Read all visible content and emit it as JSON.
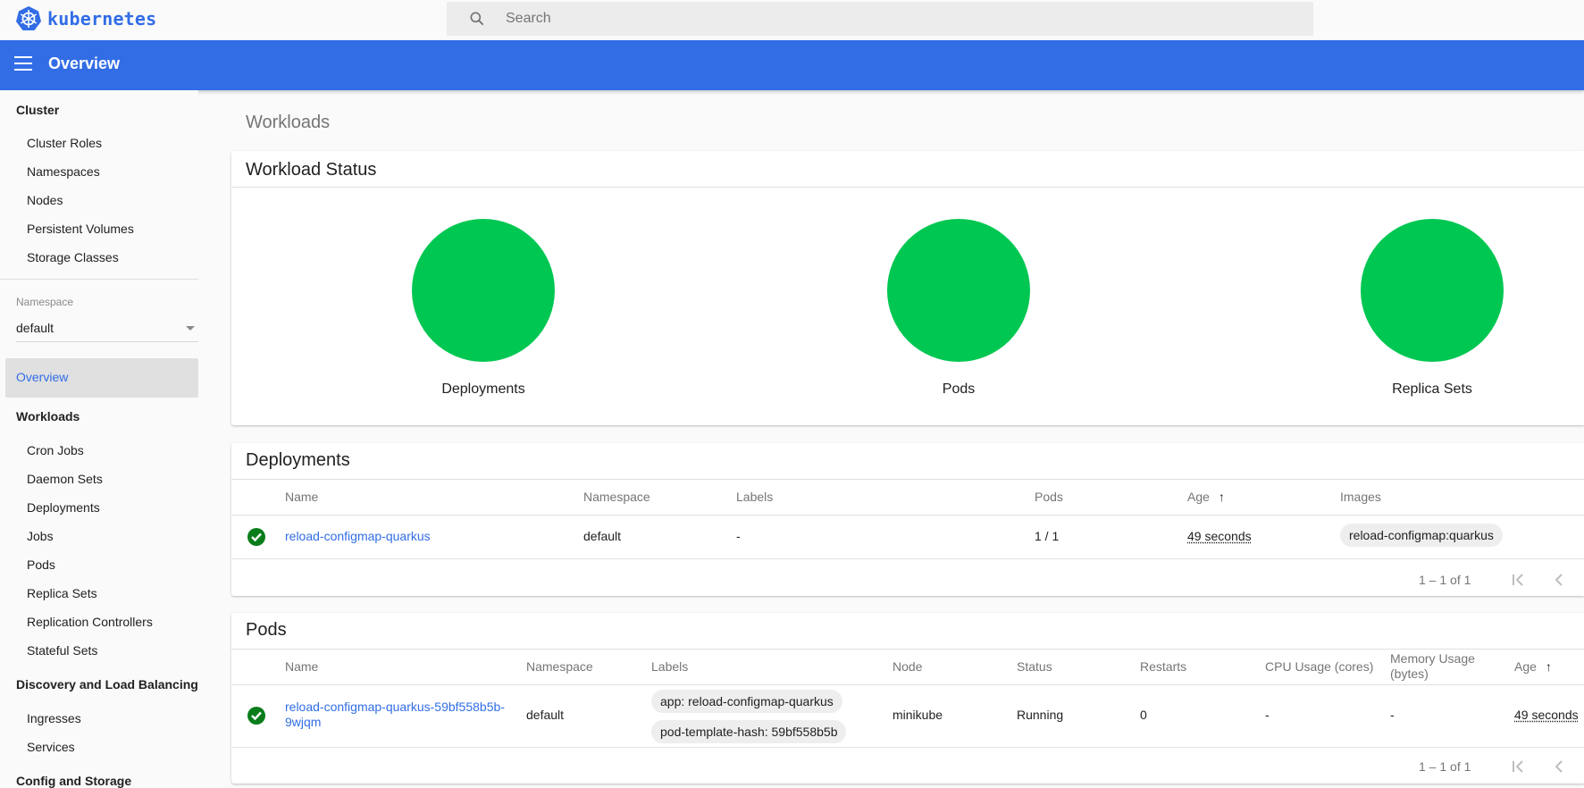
{
  "app": {
    "logo_text": "kubernetes",
    "search_placeholder": "Search",
    "page_heading": "Overview",
    "brand_color": "#326de6",
    "status_color": "#00c752"
  },
  "sidebar": {
    "cluster": {
      "heading": "Cluster",
      "items": [
        "Cluster Roles",
        "Namespaces",
        "Nodes",
        "Persistent Volumes",
        "Storage Classes"
      ]
    },
    "namespace": {
      "label": "Namespace",
      "value": "default"
    },
    "overview_label": "Overview",
    "workloads": {
      "heading": "Workloads",
      "items": [
        "Cron Jobs",
        "Daemon Sets",
        "Deployments",
        "Jobs",
        "Pods",
        "Replica Sets",
        "Replication Controllers",
        "Stateful Sets"
      ]
    },
    "discovery": {
      "heading": "Discovery and Load Balancing",
      "items": [
        "Ingresses",
        "Services"
      ]
    },
    "config": {
      "heading": "Config and Storage"
    }
  },
  "main": {
    "title": "Workloads",
    "workload_status": {
      "title": "Workload Status",
      "items": [
        {
          "label": "Deployments",
          "state": "running"
        },
        {
          "label": "Pods",
          "state": "running"
        },
        {
          "label": "Replica Sets",
          "state": "running"
        }
      ]
    },
    "deployments": {
      "title": "Deployments",
      "columns": [
        "Name",
        "Namespace",
        "Labels",
        "Pods",
        "Age",
        "Images"
      ],
      "sort_icon": "arrow-up-icon",
      "rows": [
        {
          "status": "check-circle-icon",
          "name": "reload-configmap-quarkus",
          "namespace": "default",
          "labels": "-",
          "pods": "1 / 1",
          "age": "49 seconds",
          "images": "reload-configmap:quarkus"
        }
      ],
      "pagination": "1 – 1 of 1"
    },
    "pods": {
      "title": "Pods",
      "columns": [
        "Name",
        "Namespace",
        "Labels",
        "Node",
        "Status",
        "Restarts",
        "CPU Usage (cores)",
        "Memory Usage (bytes)",
        "Age"
      ],
      "memory_col_line1": "Memory Usage",
      "memory_col_line2": "(bytes)",
      "rows": [
        {
          "status": "check-circle-icon",
          "name_line1": "reload-configmap-quarkus-59bf558b5b-",
          "name_line2": "9wjqm",
          "namespace": "default",
          "labels": [
            "app: reload-configmap-quarkus",
            "pod-template-hash: 59bf558b5b"
          ],
          "node": "minikube",
          "pod_status": "Running",
          "restarts": "0",
          "cpu": "-",
          "memory": "-",
          "age": "49 seconds"
        }
      ],
      "pagination": "1 – 1 of 1"
    }
  }
}
